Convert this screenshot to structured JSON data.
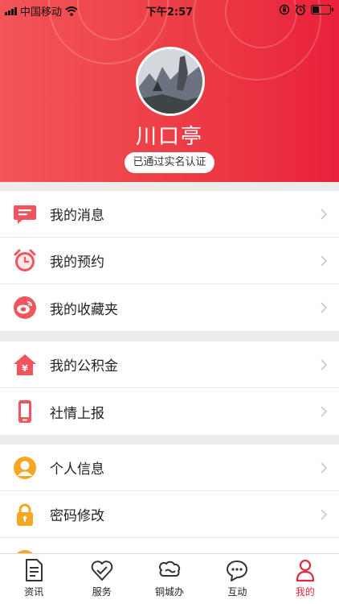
{
  "status_bar": {
    "carrier": "中国移动",
    "time": "下午2:57"
  },
  "profile": {
    "name": "川口亭",
    "verified_label": "已通过实名认证"
  },
  "menu_groups": [
    {
      "items": [
        {
          "label": "我的消息",
          "icon": "message-icon"
        },
        {
          "label": "我的预约",
          "icon": "alarm-clock-icon"
        },
        {
          "label": "我的收藏夹",
          "icon": "favorites-icon"
        }
      ]
    },
    {
      "items": [
        {
          "label": "我的公积金",
          "icon": "housing-fund-icon"
        },
        {
          "label": "社情上报",
          "icon": "phone-report-icon"
        }
      ]
    },
    {
      "items": [
        {
          "label": "个人信息",
          "icon": "user-icon"
        },
        {
          "label": "密码修改",
          "icon": "lock-icon"
        }
      ]
    }
  ],
  "tab_bar": {
    "tabs": [
      {
        "label": "资讯",
        "icon": "news-icon"
      },
      {
        "label": "服务",
        "icon": "heart-icon"
      },
      {
        "label": "铜城办",
        "icon": "city-cloud-icon"
      },
      {
        "label": "互动",
        "icon": "chat-icon"
      },
      {
        "label": "我的",
        "icon": "person-icon"
      }
    ],
    "active": "我的"
  },
  "colors": {
    "brand_red": "#e9213a",
    "accent_orange": "#f5a623"
  }
}
